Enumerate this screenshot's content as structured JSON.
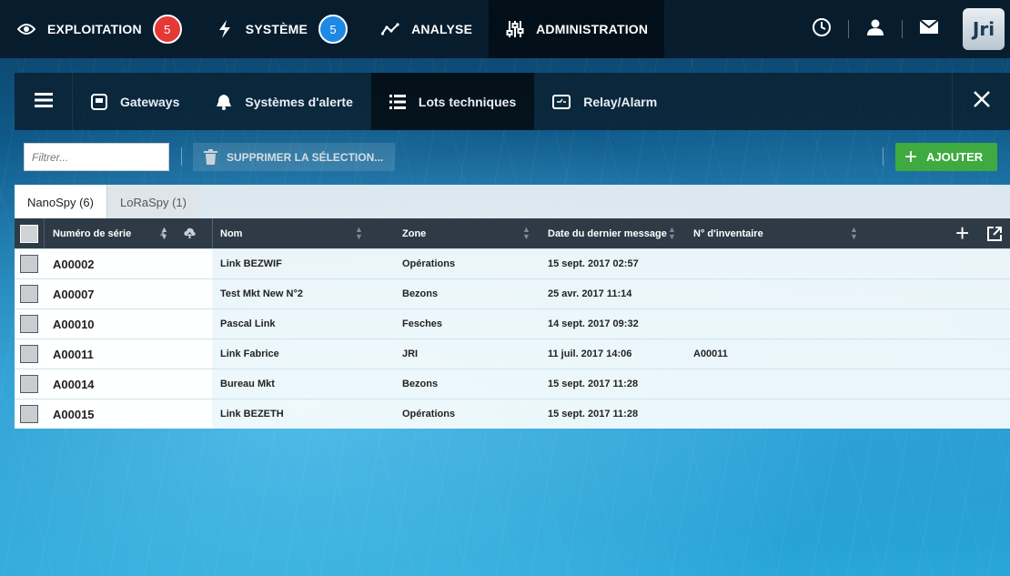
{
  "topnav": {
    "items": [
      {
        "label": "EXPLOITATION",
        "icon": "eye-icon",
        "badge": "5",
        "badge_color": "#e53935"
      },
      {
        "label": "SYSTÈME",
        "icon": "lightning-icon",
        "badge": "5",
        "badge_color": "#1e88e5"
      },
      {
        "label": "ANALYSE",
        "icon": "chart-line-icon"
      },
      {
        "label": "ADMINISTRATION",
        "icon": "sliders-icon"
      }
    ],
    "active": "ADMINISTRATION",
    "right_icons": [
      "clock-icon",
      "user-icon",
      "mail-icon"
    ],
    "logo_text": "Jri"
  },
  "tabs": {
    "items": [
      {
        "label": "Gateways",
        "icon": "gateway-icon"
      },
      {
        "label": "Systèmes d'alerte",
        "icon": "bell-icon"
      },
      {
        "label": "Lots techniques",
        "icon": "list-icon"
      },
      {
        "label": "Relay/Alarm",
        "icon": "relay-icon"
      }
    ],
    "active": "Lots techniques"
  },
  "toolbar": {
    "filter_placeholder": "Filtrer...",
    "delete_label": "SUPPRIMER LA SÉLECTION...",
    "add_label": "AJOUTER",
    "add_color": "#3faa3f"
  },
  "subtabs": [
    {
      "label": "NanoSpy (6)",
      "active": true
    },
    {
      "label": "LoRaSpy (1)",
      "active": false
    }
  ],
  "table": {
    "columns": [
      "Numéro de série",
      "Nom",
      "Zone",
      "Date du dernier message",
      "N° d'inventaire"
    ],
    "rows": [
      {
        "serial": "A00002",
        "name": "Link BEZWIF",
        "zone": "Opérations",
        "date": "15 sept. 2017 02:57",
        "inventory": ""
      },
      {
        "serial": "A00007",
        "name": "Test Mkt New N°2",
        "zone": "Bezons",
        "date": "25 avr. 2017 11:14",
        "inventory": ""
      },
      {
        "serial": "A00010",
        "name": "Pascal Link",
        "zone": "Fesches",
        "date": "14 sept. 2017 09:32",
        "inventory": ""
      },
      {
        "serial": "A00011",
        "name": "Link Fabrice",
        "zone": "JRI",
        "date": "11 juil. 2017 14:06",
        "inventory": "A00011"
      },
      {
        "serial": "A00014",
        "name": "Bureau Mkt",
        "zone": "Bezons",
        "date": "15 sept. 2017 11:28",
        "inventory": ""
      },
      {
        "serial": "A00015",
        "name": "Link BEZETH",
        "zone": "Opérations",
        "date": "15 sept. 2017 11:28",
        "inventory": ""
      }
    ]
  }
}
